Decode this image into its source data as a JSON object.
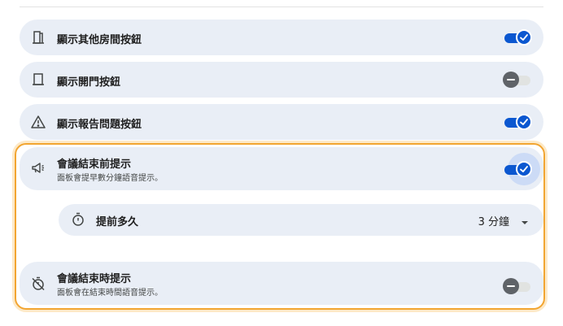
{
  "settings": {
    "other_rooms": {
      "label": "顯示其他房間按鈕",
      "enabled": true
    },
    "open_door": {
      "label": "顯示開門按鈕",
      "enabled": false
    },
    "report_issue": {
      "label": "顯示報告問題按鈕",
      "enabled": true
    },
    "meeting_end_reminder": {
      "label": "會議結束前提示",
      "description": "面板會提早數分鐘語音提示。",
      "enabled": true,
      "lead_time": {
        "label": "提前多久",
        "value": "3 分鐘"
      }
    },
    "meeting_end_time_reminder": {
      "label": "會議結束時提示",
      "description": "面板會在結束時間語音提示。",
      "enabled": false
    }
  },
  "icons": {
    "other_rooms": "door-icon",
    "open_door": "door-open-icon",
    "report_issue": "warning-icon",
    "meeting_end_reminder": "megaphone-icon",
    "lead_time": "timer-icon",
    "meeting_end_time_reminder": "timer-off-icon",
    "dropdown": "caret-down-icon",
    "check": "check-icon"
  },
  "colors": {
    "accent": "#0b57d0",
    "row_background": "#e9eef6",
    "highlight_border": "#f2a531"
  }
}
